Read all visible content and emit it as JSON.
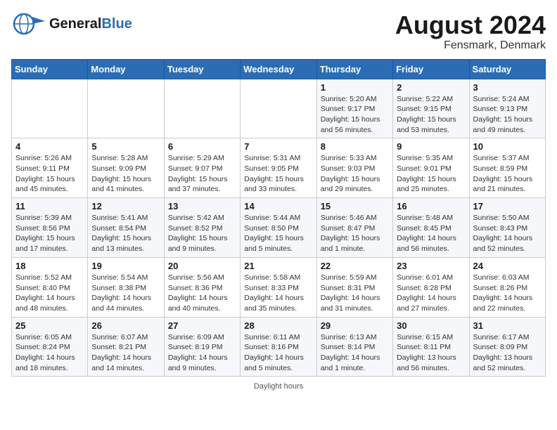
{
  "header": {
    "logo_general": "General",
    "logo_blue": "Blue",
    "title": "August 2024",
    "subtitle": "Fensmark, Denmark"
  },
  "calendar": {
    "days_of_week": [
      "Sunday",
      "Monday",
      "Tuesday",
      "Wednesday",
      "Thursday",
      "Friday",
      "Saturday"
    ],
    "weeks": [
      [
        {
          "day": "",
          "info": ""
        },
        {
          "day": "",
          "info": ""
        },
        {
          "day": "",
          "info": ""
        },
        {
          "day": "",
          "info": ""
        },
        {
          "day": "1",
          "info": "Sunrise: 5:20 AM\nSunset: 9:17 PM\nDaylight: 15 hours\nand 56 minutes."
        },
        {
          "day": "2",
          "info": "Sunrise: 5:22 AM\nSunset: 9:15 PM\nDaylight: 15 hours\nand 53 minutes."
        },
        {
          "day": "3",
          "info": "Sunrise: 5:24 AM\nSunset: 9:13 PM\nDaylight: 15 hours\nand 49 minutes."
        }
      ],
      [
        {
          "day": "4",
          "info": "Sunrise: 5:26 AM\nSunset: 9:11 PM\nDaylight: 15 hours\nand 45 minutes."
        },
        {
          "day": "5",
          "info": "Sunrise: 5:28 AM\nSunset: 9:09 PM\nDaylight: 15 hours\nand 41 minutes."
        },
        {
          "day": "6",
          "info": "Sunrise: 5:29 AM\nSunset: 9:07 PM\nDaylight: 15 hours\nand 37 minutes."
        },
        {
          "day": "7",
          "info": "Sunrise: 5:31 AM\nSunset: 9:05 PM\nDaylight: 15 hours\nand 33 minutes."
        },
        {
          "day": "8",
          "info": "Sunrise: 5:33 AM\nSunset: 9:03 PM\nDaylight: 15 hours\nand 29 minutes."
        },
        {
          "day": "9",
          "info": "Sunrise: 5:35 AM\nSunset: 9:01 PM\nDaylight: 15 hours\nand 25 minutes."
        },
        {
          "day": "10",
          "info": "Sunrise: 5:37 AM\nSunset: 8:59 PM\nDaylight: 15 hours\nand 21 minutes."
        }
      ],
      [
        {
          "day": "11",
          "info": "Sunrise: 5:39 AM\nSunset: 8:56 PM\nDaylight: 15 hours\nand 17 minutes."
        },
        {
          "day": "12",
          "info": "Sunrise: 5:41 AM\nSunset: 8:54 PM\nDaylight: 15 hours\nand 13 minutes."
        },
        {
          "day": "13",
          "info": "Sunrise: 5:42 AM\nSunset: 8:52 PM\nDaylight: 15 hours\nand 9 minutes."
        },
        {
          "day": "14",
          "info": "Sunrise: 5:44 AM\nSunset: 8:50 PM\nDaylight: 15 hours\nand 5 minutes."
        },
        {
          "day": "15",
          "info": "Sunrise: 5:46 AM\nSunset: 8:47 PM\nDaylight: 15 hours\nand 1 minute."
        },
        {
          "day": "16",
          "info": "Sunrise: 5:48 AM\nSunset: 8:45 PM\nDaylight: 14 hours\nand 56 minutes."
        },
        {
          "day": "17",
          "info": "Sunrise: 5:50 AM\nSunset: 8:43 PM\nDaylight: 14 hours\nand 52 minutes."
        }
      ],
      [
        {
          "day": "18",
          "info": "Sunrise: 5:52 AM\nSunset: 8:40 PM\nDaylight: 14 hours\nand 48 minutes."
        },
        {
          "day": "19",
          "info": "Sunrise: 5:54 AM\nSunset: 8:38 PM\nDaylight: 14 hours\nand 44 minutes."
        },
        {
          "day": "20",
          "info": "Sunrise: 5:56 AM\nSunset: 8:36 PM\nDaylight: 14 hours\nand 40 minutes."
        },
        {
          "day": "21",
          "info": "Sunrise: 5:58 AM\nSunset: 8:33 PM\nDaylight: 14 hours\nand 35 minutes."
        },
        {
          "day": "22",
          "info": "Sunrise: 5:59 AM\nSunset: 8:31 PM\nDaylight: 14 hours\nand 31 minutes."
        },
        {
          "day": "23",
          "info": "Sunrise: 6:01 AM\nSunset: 8:28 PM\nDaylight: 14 hours\nand 27 minutes."
        },
        {
          "day": "24",
          "info": "Sunrise: 6:03 AM\nSunset: 8:26 PM\nDaylight: 14 hours\nand 22 minutes."
        }
      ],
      [
        {
          "day": "25",
          "info": "Sunrise: 6:05 AM\nSunset: 8:24 PM\nDaylight: 14 hours\nand 18 minutes."
        },
        {
          "day": "26",
          "info": "Sunrise: 6:07 AM\nSunset: 8:21 PM\nDaylight: 14 hours\nand 14 minutes."
        },
        {
          "day": "27",
          "info": "Sunrise: 6:09 AM\nSunset: 8:19 PM\nDaylight: 14 hours\nand 9 minutes."
        },
        {
          "day": "28",
          "info": "Sunrise: 6:11 AM\nSunset: 8:16 PM\nDaylight: 14 hours\nand 5 minutes."
        },
        {
          "day": "29",
          "info": "Sunrise: 6:13 AM\nSunset: 8:14 PM\nDaylight: 14 hours\nand 1 minute."
        },
        {
          "day": "30",
          "info": "Sunrise: 6:15 AM\nSunset: 8:11 PM\nDaylight: 13 hours\nand 56 minutes."
        },
        {
          "day": "31",
          "info": "Sunrise: 6:17 AM\nSunset: 8:09 PM\nDaylight: 13 hours\nand 52 minutes."
        }
      ]
    ]
  },
  "footer": {
    "note": "Daylight hours"
  }
}
